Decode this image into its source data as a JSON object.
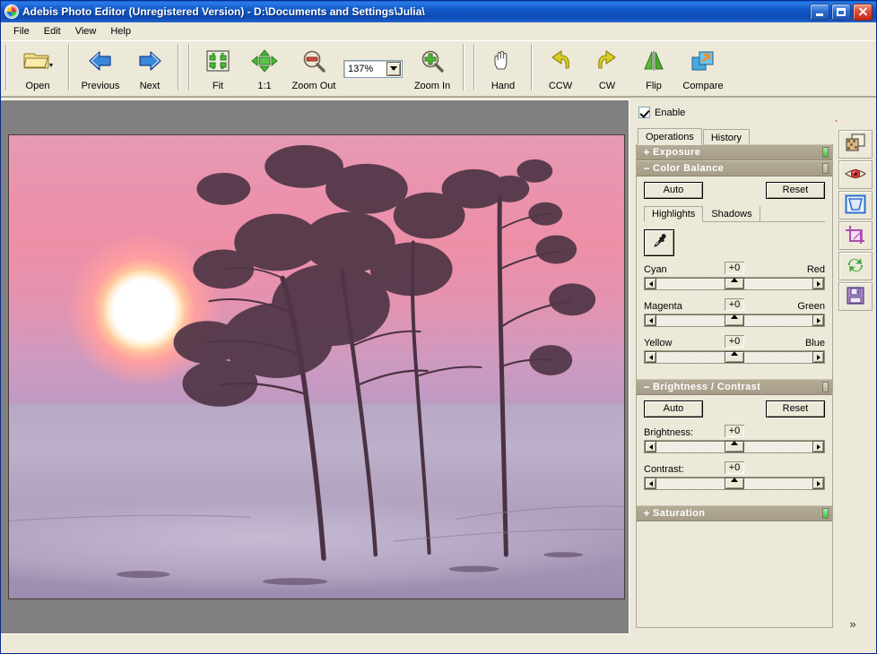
{
  "window": {
    "title": "Adebis Photo Editor (Unregistered Version) - D:\\Documents and Settings\\Julia\\",
    "app_icon": "photo-app-icon",
    "buttons": {
      "minimize": "minimize-button",
      "maximize": "maximize-button",
      "close": "close-button"
    }
  },
  "menu": {
    "items": [
      "File",
      "Edit",
      "View",
      "Help"
    ]
  },
  "toolbar": {
    "groups": [
      {
        "tools": [
          {
            "label": "Open",
            "icon": "folder-open-icon",
            "has_dropdown": true
          }
        ]
      },
      {
        "tools": [
          {
            "label": "Previous",
            "icon": "arrow-left-icon"
          },
          {
            "label": "Next",
            "icon": "arrow-right-icon"
          }
        ]
      },
      {
        "tools": [
          {
            "label": "Fit",
            "icon": "fit-to-window-icon"
          },
          {
            "label": "1:1",
            "icon": "actual-size-icon"
          },
          {
            "label": "Zoom Out",
            "icon": "zoom-out-icon"
          }
        ]
      },
      {
        "zoom_combo": {
          "value": "137%",
          "icon": "chevron-down-icon"
        }
      },
      {
        "tools": [
          {
            "label": "Zoom In",
            "icon": "zoom-in-icon"
          }
        ]
      },
      {
        "tools": [
          {
            "label": "Hand",
            "icon": "hand-icon"
          }
        ]
      },
      {
        "tools": [
          {
            "label": "CCW",
            "icon": "rotate-ccw-icon"
          },
          {
            "label": "CW",
            "icon": "rotate-cw-icon"
          },
          {
            "label": "Flip",
            "icon": "flip-horizontal-icon"
          },
          {
            "label": "Compare",
            "icon": "compare-icon"
          }
        ]
      }
    ]
  },
  "canvas": {
    "background_color": "#808080",
    "image": {
      "description": "Winter sunset photograph: large white sun with pink-orange halo low in a magenta-pink sky above a lavender snow field with dark bare pine trees on the right",
      "border_color": "#4a3a3a"
    }
  },
  "panel": {
    "enable": {
      "label": "Enable",
      "checked": true
    },
    "histogram_icon": "histogram-icon",
    "tabs": [
      {
        "label": "Operations",
        "active": true
      },
      {
        "label": "History",
        "active": false
      }
    ],
    "sections": [
      {
        "id": "exposure",
        "name": "Exposure",
        "expanded": false,
        "toggle": "+",
        "indicator": "on"
      },
      {
        "id": "color-balance",
        "name": "Color Balance",
        "expanded": true,
        "toggle": "−",
        "indicator": "off",
        "auto_label": "Auto",
        "reset_label": "Reset",
        "subtabs": [
          {
            "label": "Highlights",
            "active": true
          },
          {
            "label": "Shadows",
            "active": false
          }
        ],
        "eyedropper_icon": "eyedropper-icon",
        "sliders": [
          {
            "left": "Cyan",
            "right": "Red",
            "value": "+0"
          },
          {
            "left": "Magenta",
            "right": "Green",
            "value": "+0"
          },
          {
            "left": "Yellow",
            "right": "Blue",
            "value": "+0"
          }
        ]
      },
      {
        "id": "brightness-contrast",
        "name": "Brightness / Contrast",
        "expanded": true,
        "toggle": "−",
        "indicator": "off",
        "auto_label": "Auto",
        "reset_label": "Reset",
        "sliders": [
          {
            "left": "Brightness:",
            "right": "",
            "value": "+0"
          },
          {
            "left": "Contrast:",
            "right": "",
            "value": "+0"
          }
        ]
      },
      {
        "id": "saturation",
        "name": "Saturation",
        "expanded": false,
        "toggle": "+",
        "indicator": "on"
      }
    ]
  },
  "iconbar": {
    "items": [
      {
        "icon": "levels-thumbnail-icon"
      },
      {
        "icon": "red-eye-icon"
      },
      {
        "icon": "frame-border-icon"
      },
      {
        "icon": "crop-icon"
      },
      {
        "icon": "rotate-refresh-icon"
      },
      {
        "icon": "save-disk-icon"
      }
    ],
    "expander": "»"
  },
  "colors": {
    "titlebar_blue": "#1157c9",
    "window_face": "#ece9d8",
    "section_header": "#a59d88",
    "canvas_gray": "#808080",
    "indicator_green": "#3fbf3f"
  }
}
